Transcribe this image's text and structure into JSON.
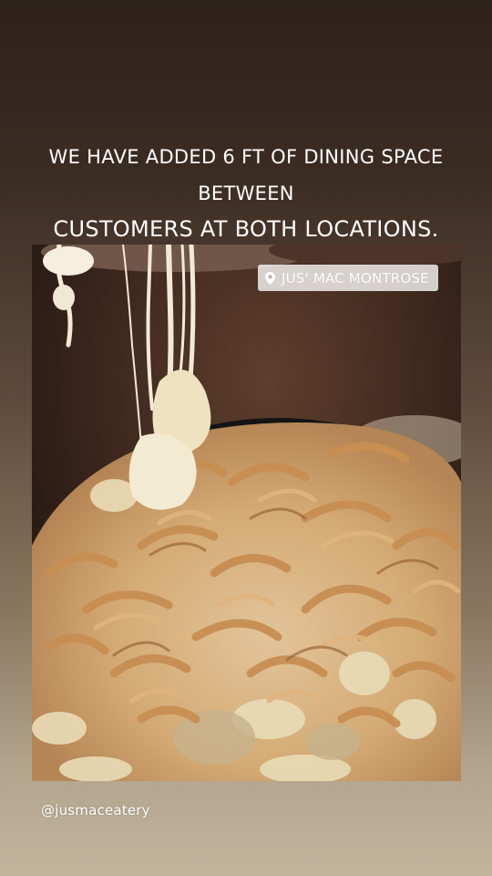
{
  "story": {
    "headline_line_1": "WE HAVE ADDED 6 FT OF DINING SPACE BETWEEN",
    "headline_line_2": "CUSTOMERS AT BOTH LOCATIONS.",
    "location_sticker": "JUS' MAC MONTROSE",
    "mention_sticker": "@jusmaceatery"
  },
  "icons": {
    "location": "location-pin-icon"
  },
  "colors": {
    "text": "#ffffff",
    "background_top": "#2e221c",
    "background_bottom": "#c2b59c",
    "sticker_background": "#ffffffc7"
  }
}
